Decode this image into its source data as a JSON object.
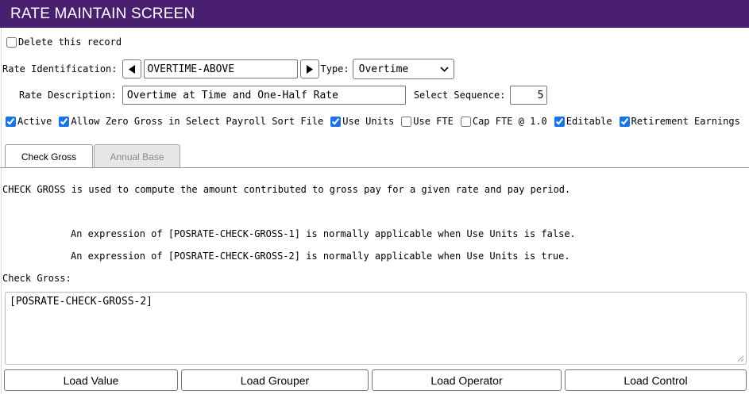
{
  "header": {
    "title": "RATE MAINTAIN SCREEN"
  },
  "delete_record": {
    "label": "Delete this record",
    "checked": false
  },
  "rate_identification": {
    "label": "Rate Identification:",
    "value": "OVERTIME-ABOVE"
  },
  "type": {
    "label": "Type:",
    "value": "Overtime"
  },
  "rate_description": {
    "label": "Rate Description:",
    "value": "Overtime at Time and One-Half Rate"
  },
  "select_sequence": {
    "label": "Select Sequence:",
    "value": "5"
  },
  "flags": [
    {
      "label": "Active",
      "checked": true
    },
    {
      "label": "Allow Zero Gross in Select Payroll Sort File",
      "checked": true
    },
    {
      "label": "Use Units",
      "checked": true
    },
    {
      "label": "Use FTE",
      "checked": false
    },
    {
      "label": "Cap FTE @ 1.0",
      "checked": false
    },
    {
      "label": "Editable",
      "checked": true
    },
    {
      "label": "Retirement Earnings",
      "checked": true
    }
  ],
  "tabs": [
    {
      "label": "Check Gross",
      "active": true
    },
    {
      "label": "Annual Base",
      "active": false
    }
  ],
  "help": {
    "line1": "CHECK GROSS is used to compute the amount contributed to gross pay for a given rate and pay period.",
    "line2": "An expression of [POSRATE-CHECK-GROSS-1] is normally applicable when Use Units is false.",
    "line3": "An expression of [POSRATE-CHECK-GROSS-2] is normally applicable when Use Units is true."
  },
  "check_gross": {
    "label": "Check Gross:",
    "value": "[POSRATE-CHECK-GROSS-2]"
  },
  "buttons": {
    "load_value": "Load Value",
    "load_grouper": "Load Grouper",
    "load_operator": "Load Operator",
    "load_control": "Load Control"
  }
}
